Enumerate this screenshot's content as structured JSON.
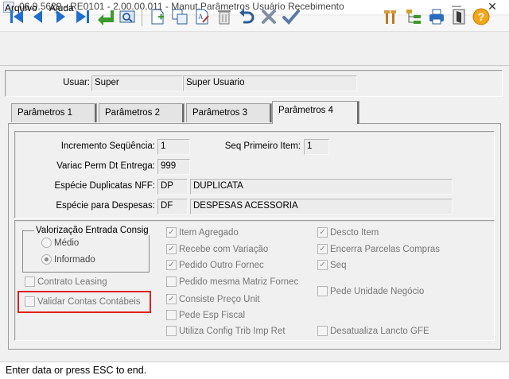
{
  "window": {
    "title": "06.9.5629 - RE0101 - 2.00.00.011 - Manut.Parâmetros Usuário Recebimento",
    "minimize": "—",
    "close": "✕"
  },
  "menu": {
    "items": [
      "Arquivo",
      "Ajuda"
    ]
  },
  "toolbar": {
    "icons": [
      "first-record-icon",
      "prev-record-icon",
      "next-record-icon",
      "last-record-icon",
      "goto-icon",
      "search-zoom-icon",
      "new-record-icon",
      "copy-record-icon",
      "edit-record-icon",
      "delete-record-icon",
      "undo-icon",
      "cancel-icon",
      "confirm-icon",
      "tools-icon",
      "tree-icon",
      "print-icon",
      "exit-icon",
      "help-icon"
    ]
  },
  "user": {
    "label": "Usuar:",
    "code": "Super",
    "name": "Super Usuario"
  },
  "tabs": [
    {
      "label": "Parâmetros 1"
    },
    {
      "label": "Parâmetros 2"
    },
    {
      "label": "Parâmetros 3"
    },
    {
      "label": "Parâmetros 4"
    }
  ],
  "params": {
    "incremento_label": "Incremento Seqüência:",
    "incremento_value": "1",
    "seq_primeiro_label": "Seq Primeiro Item:",
    "seq_primeiro_value": "1",
    "variac_label": "Variac Perm Dt Entrega:",
    "variac_value": "999",
    "especie_dup_label": "Espécie Duplicatas NFF:",
    "especie_dup_code": "DP",
    "especie_dup_desc": "DUPLICATA",
    "especie_desp_label": "Espécie para Despesas:",
    "especie_desp_code": "DF",
    "especie_desp_desc": "DESPESAS ACESSORIA"
  },
  "valorizacao": {
    "title": "Valorização Entrada Consig",
    "options": [
      {
        "label": "Médio",
        "selected": false
      },
      {
        "label": "Informado",
        "selected": true
      }
    ]
  },
  "checks_left": [
    {
      "label": "Contrato Leasing",
      "checked": false
    },
    {
      "label": "Validar Contas Contábeis",
      "checked": false
    }
  ],
  "checks_mid": [
    {
      "label": "Item Agregado",
      "checked": true
    },
    {
      "label": "Recebe com Variação",
      "checked": true
    },
    {
      "label": "Pedido Outro Fornec",
      "checked": true
    },
    {
      "label": "Pedido mesma Matriz Fornec",
      "checked": false
    },
    {
      "label": "Consiste Preço Unit",
      "checked": true
    },
    {
      "label": "Pede Esp Fiscal",
      "checked": false
    },
    {
      "label": "Utiliza Config Trib Imp Ret",
      "checked": false
    }
  ],
  "checks_right": [
    {
      "label": "Descto Item",
      "checked": true
    },
    {
      "label": "Encerra Parcelas Compras",
      "checked": true
    },
    {
      "label": "Seq",
      "checked": true
    },
    {
      "label": "Pede Unidade Negócio",
      "checked": false
    },
    {
      "label": "Desatualiza Lancto GFE",
      "checked": false
    }
  ],
  "check_mark": "✓",
  "status": {
    "text": "Enter data or press ESC to end."
  }
}
